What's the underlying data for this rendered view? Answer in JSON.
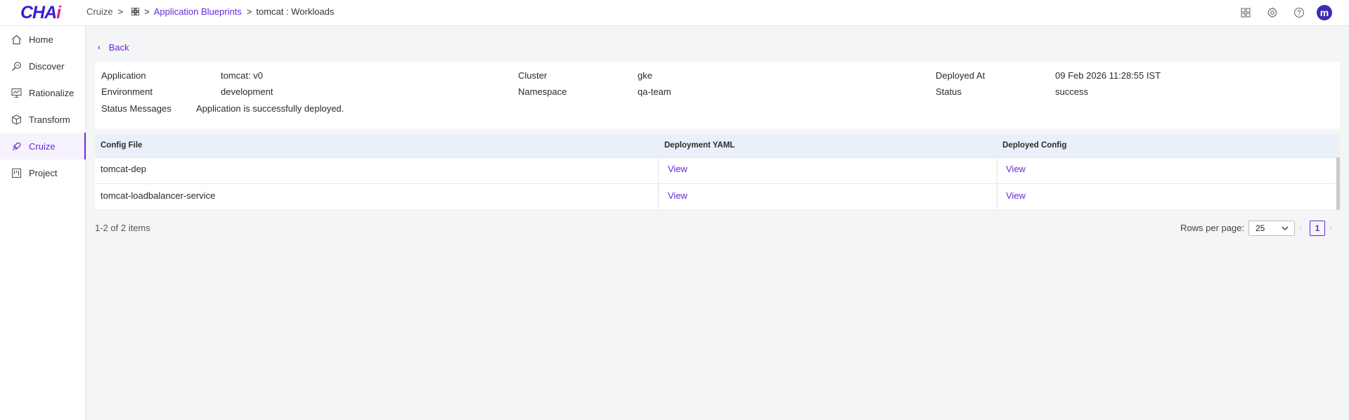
{
  "app": {
    "logo_main": "CHA",
    "logo_accent": "i"
  },
  "breadcrumb": {
    "root": "Cruize",
    "sep1": ">",
    "sep2": ">",
    "blueprints": "Application Blueprints",
    "sep3": ">",
    "current": "tomcat : Workloads"
  },
  "header": {
    "avatar_letter": "m"
  },
  "sidebar": {
    "items": [
      {
        "label": "Home",
        "icon": "home-icon"
      },
      {
        "label": "Discover",
        "icon": "discover-icon"
      },
      {
        "label": "Rationalize",
        "icon": "rationalize-icon"
      },
      {
        "label": "Transform",
        "icon": "cube-icon"
      },
      {
        "label": "Cruize",
        "icon": "cruize-icon",
        "active": true
      },
      {
        "label": "Project",
        "icon": "project-icon"
      }
    ]
  },
  "back": {
    "label": "Back"
  },
  "details": {
    "application_label": "Application",
    "application_value": "tomcat: v0",
    "cluster_label": "Cluster",
    "cluster_value": "gke",
    "deployed_at_label": "Deployed At",
    "deployed_at_value": "09 Feb 2026 11:28:55 IST",
    "environment_label": "Environment",
    "environment_value": "development",
    "namespace_label": "Namespace",
    "namespace_value": "qa-team",
    "status_label": "Status",
    "status_value": "success",
    "status_messages_label": "Status Messages",
    "status_messages_value": "Application is successfully deployed."
  },
  "table": {
    "headers": [
      "Config File",
      "Deployment YAML",
      "Deployed Config"
    ],
    "rows": [
      {
        "config_file": "tomcat-dep",
        "deployment_yaml": "View",
        "deployed_config": "View"
      },
      {
        "config_file": "tomcat-loadbalancer-service",
        "deployment_yaml": "View",
        "deployed_config": "View"
      }
    ]
  },
  "pagination": {
    "summary": "1-2 of 2 items",
    "rows_per_page_label": "Rows per page:",
    "rows_per_page_value": "25",
    "current_page": "1",
    "prev": "‹",
    "next": "›"
  },
  "colors": {
    "accent": "#6a27d9",
    "logo": "#3f1bd1",
    "logo_accent": "#e0218a",
    "avatar": "#3a2db4",
    "table_header": "#e9f0f9"
  }
}
